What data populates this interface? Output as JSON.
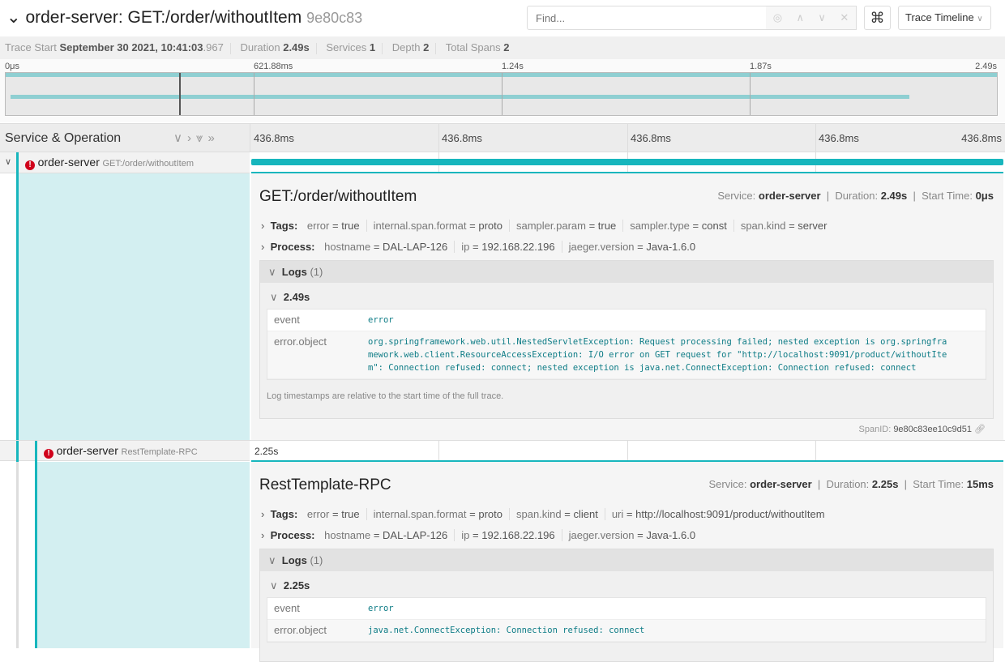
{
  "header": {
    "title": "order-server: GET:/order/withoutItem",
    "trace_id": "9e80c83",
    "find_placeholder": "Find...",
    "keyboard_icon": "⌘",
    "view_label": "Trace Timeline"
  },
  "summary": {
    "trace_start_label": "Trace Start",
    "trace_start_value": "September 30 2021, 10:41:03",
    "trace_start_ms": ".967",
    "duration_label": "Duration",
    "duration_value": "2.49s",
    "services_label": "Services",
    "services_value": "1",
    "depth_label": "Depth",
    "depth_value": "2",
    "total_spans_label": "Total Spans",
    "total_spans_value": "2"
  },
  "minimap": {
    "ticks": [
      "0μs",
      "621.88ms",
      "1.24s",
      "1.87s",
      "2.49s"
    ]
  },
  "table": {
    "header_label": "Service & Operation",
    "ticks": [
      "436.8ms",
      "436.8ms",
      "436.8ms",
      "436.8ms",
      "436.8ms"
    ]
  },
  "colors": {
    "accent": "#17b6bd",
    "error": "#d0021b",
    "tint": "#d3eff1"
  },
  "spans": [
    {
      "service": "order-server",
      "operation": "GET:/order/withoutItem",
      "error": true,
      "detail": {
        "title": "GET:/order/withoutItem",
        "service_label": "Service:",
        "service": "order-server",
        "duration_label": "Duration:",
        "duration": "2.49s",
        "start_label": "Start Time:",
        "start": "0μs",
        "tags_label": "Tags:",
        "tags": [
          {
            "k": "error",
            "v": "true"
          },
          {
            "k": "internal.span.format",
            "v": "proto"
          },
          {
            "k": "sampler.param",
            "v": "true"
          },
          {
            "k": "sampler.type",
            "v": "const"
          },
          {
            "k": "span.kind",
            "v": "server"
          }
        ],
        "process_label": "Process:",
        "process": [
          {
            "k": "hostname",
            "v": "DAL-LAP-126"
          },
          {
            "k": "ip",
            "v": "192.168.22.196"
          },
          {
            "k": "jaeger.version",
            "v": "Java-1.6.0"
          }
        ],
        "logs_label": "Logs",
        "logs_count": "(1)",
        "log_time": "2.49s",
        "log_fields": [
          {
            "k": "event",
            "v": "error"
          },
          {
            "k": "error.object",
            "v": "org.springframework.web.util.NestedServletException: Request processing failed; nested exception is org.springframework.web.client.ResourceAccessException: I/O error on GET request for \"http://localhost:9091/product/withoutItem\": Connection refused: connect; nested exception is java.net.ConnectException: Connection refused: connect"
          }
        ],
        "log_note": "Log timestamps are relative to the start time of the full trace.",
        "span_id_label": "SpanID:",
        "span_id": "9e80c83ee10c9d51"
      }
    },
    {
      "service": "order-server",
      "operation": "RestTemplate-RPC",
      "error": true,
      "bar_label": "2.25s",
      "detail": {
        "title": "RestTemplate-RPC",
        "service_label": "Service:",
        "service": "order-server",
        "duration_label": "Duration:",
        "duration": "2.25s",
        "start_label": "Start Time:",
        "start": "15ms",
        "tags_label": "Tags:",
        "tags": [
          {
            "k": "error",
            "v": "true"
          },
          {
            "k": "internal.span.format",
            "v": "proto"
          },
          {
            "k": "span.kind",
            "v": "client"
          },
          {
            "k": "uri",
            "v": "http://localhost:9091/product/withoutItem"
          }
        ],
        "process_label": "Process:",
        "process": [
          {
            "k": "hostname",
            "v": "DAL-LAP-126"
          },
          {
            "k": "ip",
            "v": "192.168.22.196"
          },
          {
            "k": "jaeger.version",
            "v": "Java-1.6.0"
          }
        ],
        "logs_label": "Logs",
        "logs_count": "(1)",
        "log_time": "2.25s",
        "log_fields": [
          {
            "k": "event",
            "v": "error"
          },
          {
            "k": "error.object",
            "v": "java.net.ConnectException: Connection refused: connect"
          }
        ]
      }
    }
  ]
}
